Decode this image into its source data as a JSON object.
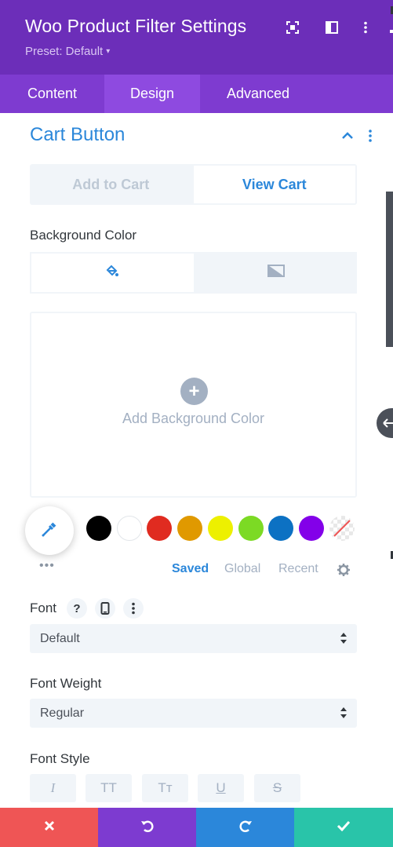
{
  "header": {
    "title": "Woo Product Filter Settings",
    "preset": "Preset: Default",
    "preset_caret": "▾"
  },
  "tabs": [
    {
      "label": "Content"
    },
    {
      "label": "Design",
      "active": true
    },
    {
      "label": "Advanced"
    }
  ],
  "section": {
    "title": "Cart Button"
  },
  "cart_toggle": {
    "options": [
      "Add to Cart",
      "View Cart"
    ],
    "active": "View Cart"
  },
  "background": {
    "label": "Background Color",
    "add_label": "Add Background Color",
    "plus_symbol": "+"
  },
  "palette": {
    "swatches": [
      "#000000",
      "#ffffff",
      "#e02b20",
      "#e09900",
      "#edf000",
      "#7cda24",
      "#0c71c3",
      "#8300e9",
      "none"
    ],
    "more": "•••",
    "tabs": [
      "Saved",
      "Global",
      "Recent"
    ],
    "active_tab": "Saved"
  },
  "font": {
    "label": "Font",
    "help_symbol": "?",
    "value": "Default"
  },
  "font_weight": {
    "label": "Font Weight",
    "value": "Regular"
  },
  "font_style": {
    "label": "Font Style",
    "buttons": [
      "I",
      "TT",
      "Tт",
      "U",
      "S"
    ]
  },
  "colors": {
    "header": "#6c2eb9",
    "tabs": "#7e3bd0",
    "accent": "#2b87da",
    "cancel": "#ef5555",
    "undo": "#7d3bd0",
    "redo": "#2b87da",
    "save": "#29c4a9"
  }
}
